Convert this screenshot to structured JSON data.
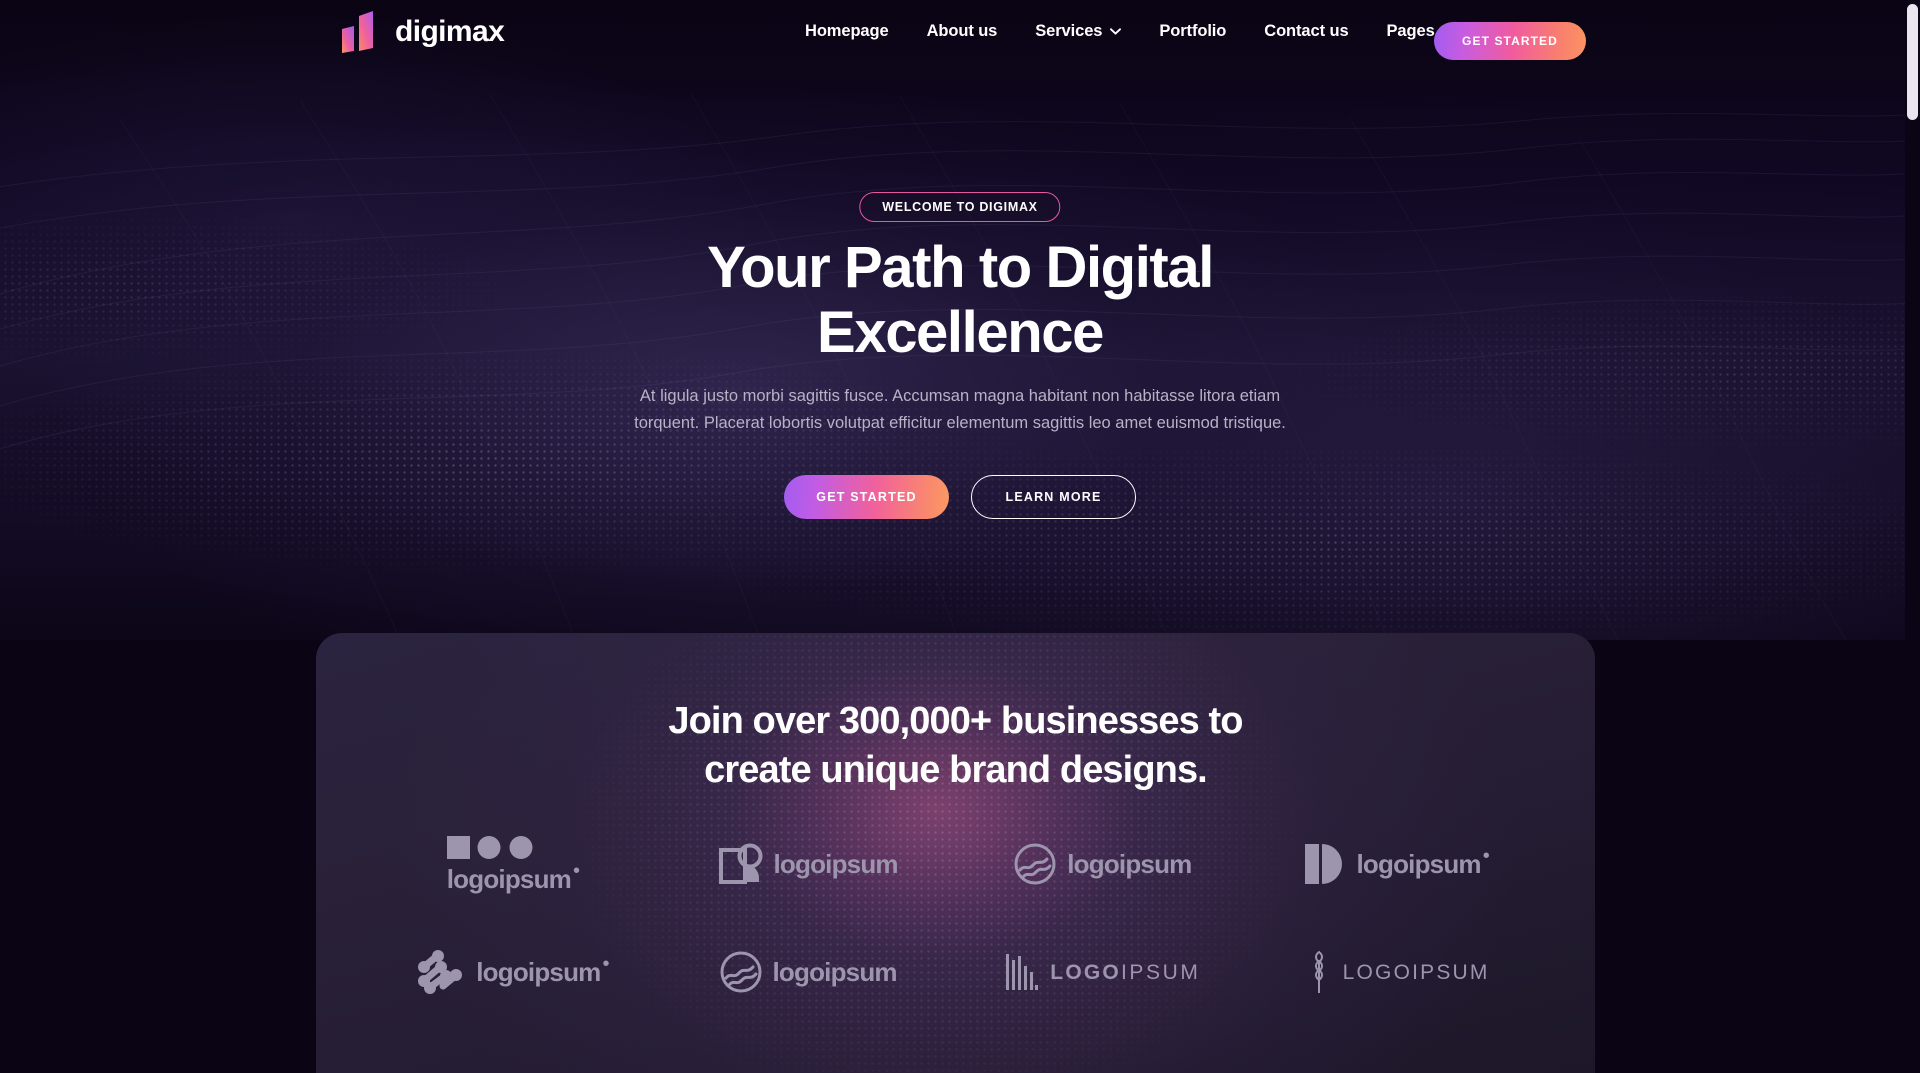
{
  "brand": {
    "name": "digimax",
    "logo_icon": "bar-chart-logo-icon",
    "gradient_from": "#a25cf0",
    "gradient_mid": "#f1619b",
    "gradient_to": "#fb9a63"
  },
  "header": {
    "nav": [
      {
        "label": "Homepage",
        "has_dropdown": false
      },
      {
        "label": "About us",
        "has_dropdown": false
      },
      {
        "label": "Services",
        "has_dropdown": true
      },
      {
        "label": "Portfolio",
        "has_dropdown": false
      },
      {
        "label": "Contact us",
        "has_dropdown": false
      },
      {
        "label": "Pages",
        "has_dropdown": true
      }
    ],
    "cta_label": "GET STARTED"
  },
  "hero": {
    "badge": "WELCOME TO DIGIMAX",
    "title_line1": "Your Path to Digital",
    "title_line2": "Excellence",
    "paragraph": "At ligula justo morbi sagittis fusce. Accumsan magna habitant non habitasse litora etiam torquent. Placerat lobortis volutpat efficitur elementum sagittis leo amet euismod tristique.",
    "primary_cta": "GET STARTED",
    "secondary_cta": "LEARN MORE"
  },
  "brands": {
    "title_line1": "Join over 300,000+ businesses to",
    "title_line2": "create unique brand designs.",
    "logos": [
      {
        "name": "logoipsum",
        "icon": "squares-circles-icon",
        "style": "stacked",
        "dot": true
      },
      {
        "name": "logoipsum",
        "icon": "square-circle-icon",
        "style": "inline",
        "dot": false
      },
      {
        "name": "logoipsum",
        "icon": "circle-waves-icon",
        "style": "inline",
        "dot": false
      },
      {
        "name": "logoipsum",
        "icon": "half-circle-block-icon",
        "style": "inline",
        "dot": true
      },
      {
        "name": "logoipsum",
        "icon": "nodes-chain-icon",
        "style": "inline",
        "dot": true
      },
      {
        "name": "logoipsum",
        "icon": "circle-waves-icon",
        "style": "inline",
        "dot": false
      },
      {
        "name": "LOGOIPSUM",
        "icon": "equalizer-bars-icon",
        "style": "wide",
        "bold_part": "LOGO",
        "thin_part": "IPSUM"
      },
      {
        "name": "LOGOIPSUM",
        "icon": "wheat-stalk-icon",
        "style": "wide-outline",
        "bold_part": "LOGO",
        "thin_part": "IPSUM"
      }
    ]
  },
  "scrollbar": {
    "position": "top"
  },
  "colors": {
    "page_bg": "#0b0414",
    "hero_bg": "#140c25",
    "card_bg": "#2a2139",
    "accent_pink": "#e8569f",
    "text_primary": "#ffffff",
    "text_muted": "#b8b2c6",
    "logo_grey": "#9d95ad"
  }
}
